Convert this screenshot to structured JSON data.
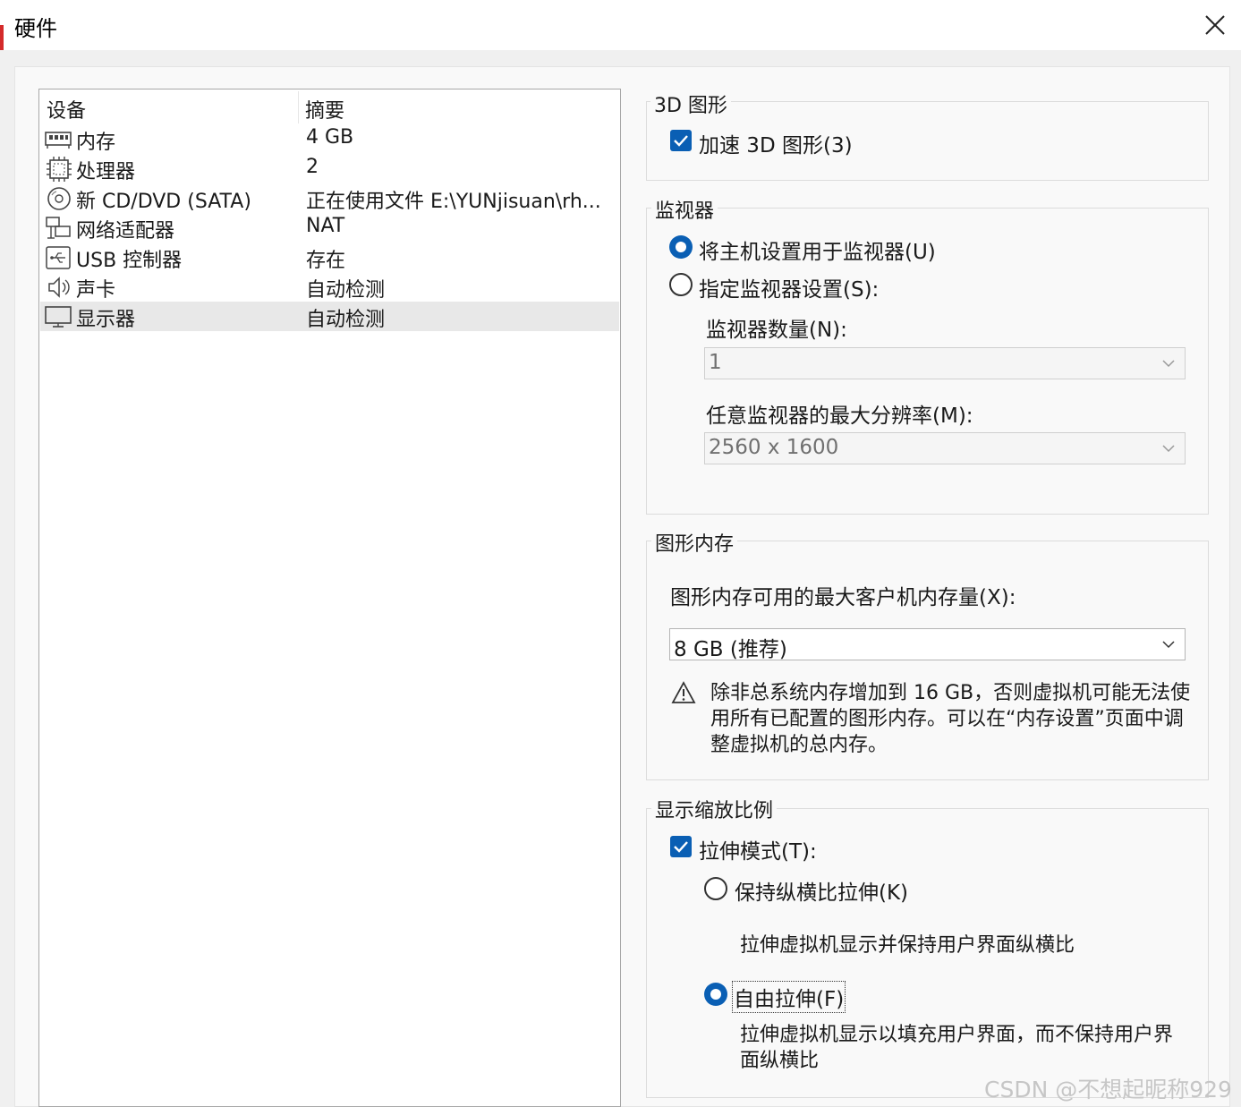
{
  "window": {
    "title": "硬件"
  },
  "device_list": {
    "columns": [
      "设备",
      "摘要"
    ],
    "rows": [
      {
        "icon": "memory-icon",
        "name": "内存",
        "summary": "4 GB"
      },
      {
        "icon": "processor-icon",
        "name": "处理器",
        "summary": "2"
      },
      {
        "icon": "cd-dvd-icon",
        "name": "新 CD/DVD (SATA)",
        "summary": "正在使用文件 E:\\YUNjisuan\\rh..."
      },
      {
        "icon": "network-adapter-icon",
        "name": "网络适配器",
        "summary": "NAT"
      },
      {
        "icon": "usb-icon",
        "name": "USB 控制器",
        "summary": "存在"
      },
      {
        "icon": "sound-card-icon",
        "name": "声卡",
        "summary": "自动检测"
      },
      {
        "icon": "display-icon",
        "name": "显示器",
        "summary": "自动检测",
        "selected": true
      }
    ]
  },
  "graphics3d": {
    "title": "3D 图形",
    "accelerate_label": "加速 3D 图形(3)",
    "accelerate_checked": true
  },
  "monitor": {
    "title": "监视器",
    "use_host_label": "将主机设置用于监视器(U)",
    "specify_label": "指定监视器设置(S):",
    "selected": "use_host",
    "count_label": "监视器数量(N):",
    "count_value": "1",
    "max_res_label": "任意监视器的最大分辨率(M):",
    "max_res_value": "2560 x 1600"
  },
  "graphics_memory": {
    "title": "图形内存",
    "max_label": "图形内存可用的最大客户机内存量(X):",
    "value": "8 GB (推荐)",
    "warning": "除非总系统内存增加到 16 GB，否则虚拟机可能无法使用所有已配置的图形内存。可以在“内存设置”页面中调整虚拟机的总内存。"
  },
  "scaling": {
    "title": "显示缩放比例",
    "stretch_label": "拉伸模式(T):",
    "stretch_checked": true,
    "keep_aspect_label": "保持纵横比拉伸(K)",
    "keep_aspect_desc": "拉伸虚拟机显示并保持用户界面纵横比",
    "free_label": "自由拉伸(F)",
    "free_desc": "拉伸虚拟机显示以填充用户界面，而不保持用户界面纵横比",
    "selected": "free"
  },
  "watermark": "CSDN @不想起昵称929",
  "colors": {
    "accent": "#0a5fb4",
    "selection": "#e8e8e8",
    "panel": "#f9f9f9"
  }
}
